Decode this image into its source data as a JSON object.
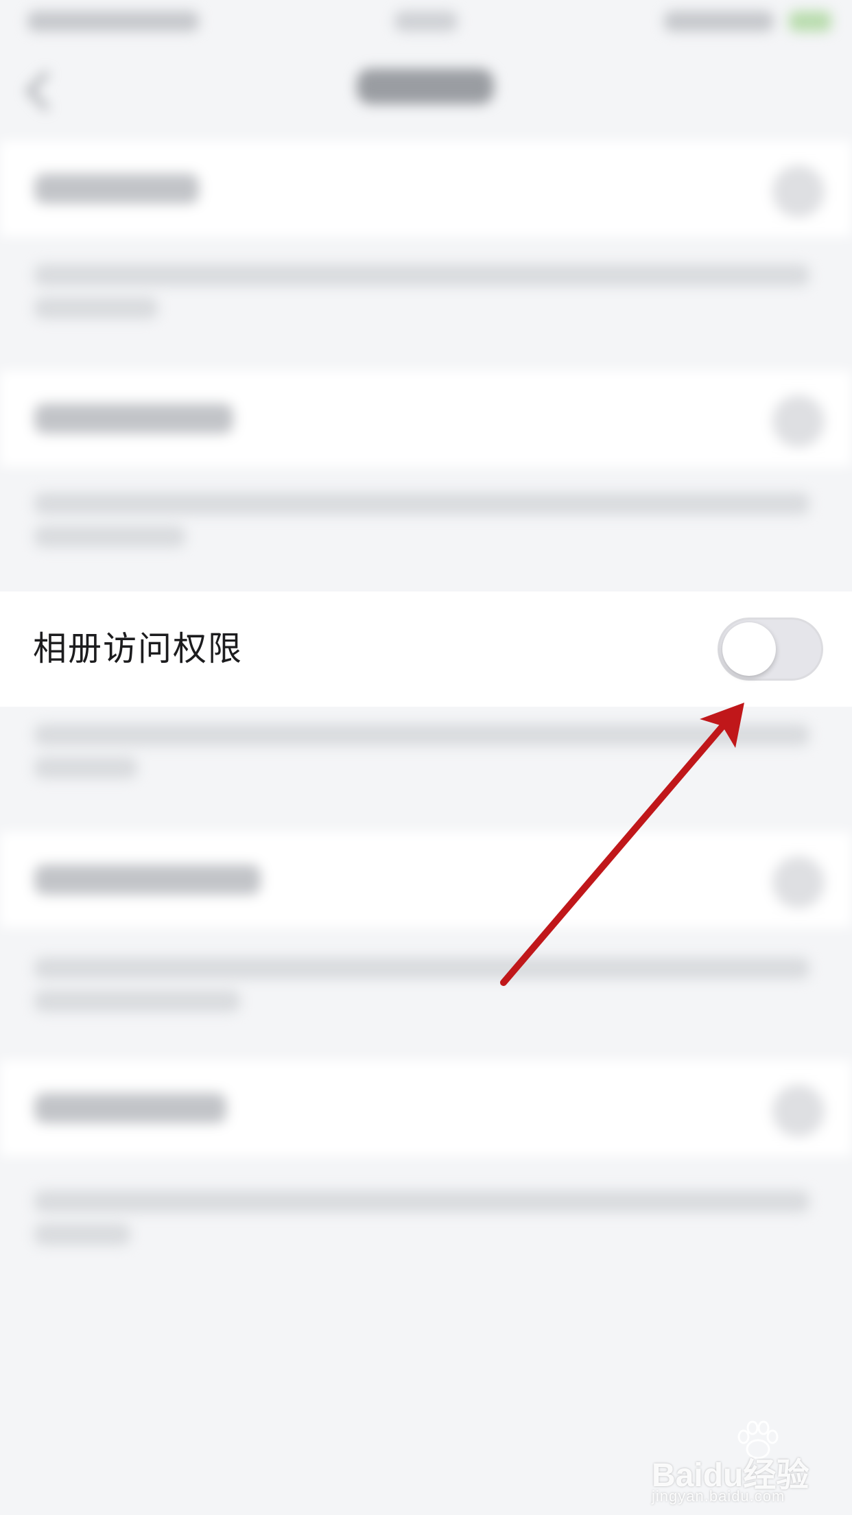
{
  "setting": {
    "label": "相册访问权限",
    "enabled": false
  },
  "colors": {
    "background": "#f4f5f7",
    "row_background": "#ffffff",
    "label_text": "#1c1c1e",
    "switch_off_track": "#e5e5ea",
    "annotation_arrow": "#c0171a"
  },
  "icons": {
    "back": "chevron-left-icon",
    "annotation": "red-arrow-annotation"
  },
  "watermark": {
    "brand": "Baidu经验",
    "url": "jingyan.baidu.com"
  }
}
